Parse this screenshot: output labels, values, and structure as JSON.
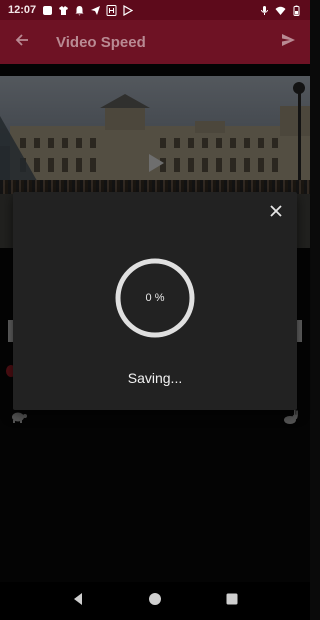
{
  "status_bar": {
    "time": "12:07",
    "left_icons": [
      "white-square-icon",
      "shirt-icon",
      "bell-icon",
      "send-icon",
      "h-box-icon",
      "play-store-icon"
    ],
    "right_icons": [
      "mic-icon",
      "wifi-icon",
      "battery-icon"
    ]
  },
  "app_bar": {
    "title": "Video Speed",
    "back_icon": "arrow-back-icon",
    "send_icon": "send-icon"
  },
  "dialog": {
    "progress_value": "0 %",
    "progress_fraction": 0,
    "status_text": "Saving...",
    "close_icon": "close-icon"
  },
  "controls": {
    "slow_icon": "turtle-icon",
    "fast_icon": "rabbit-icon"
  },
  "navigation": {
    "back": "nav-back-icon",
    "home": "nav-home-icon",
    "recents": "nav-recents-icon"
  },
  "colors": {
    "status_bar": "#5d0a1b",
    "app_bar": "#6e1224",
    "dialog": "#222222",
    "accent": "#b0202a"
  }
}
